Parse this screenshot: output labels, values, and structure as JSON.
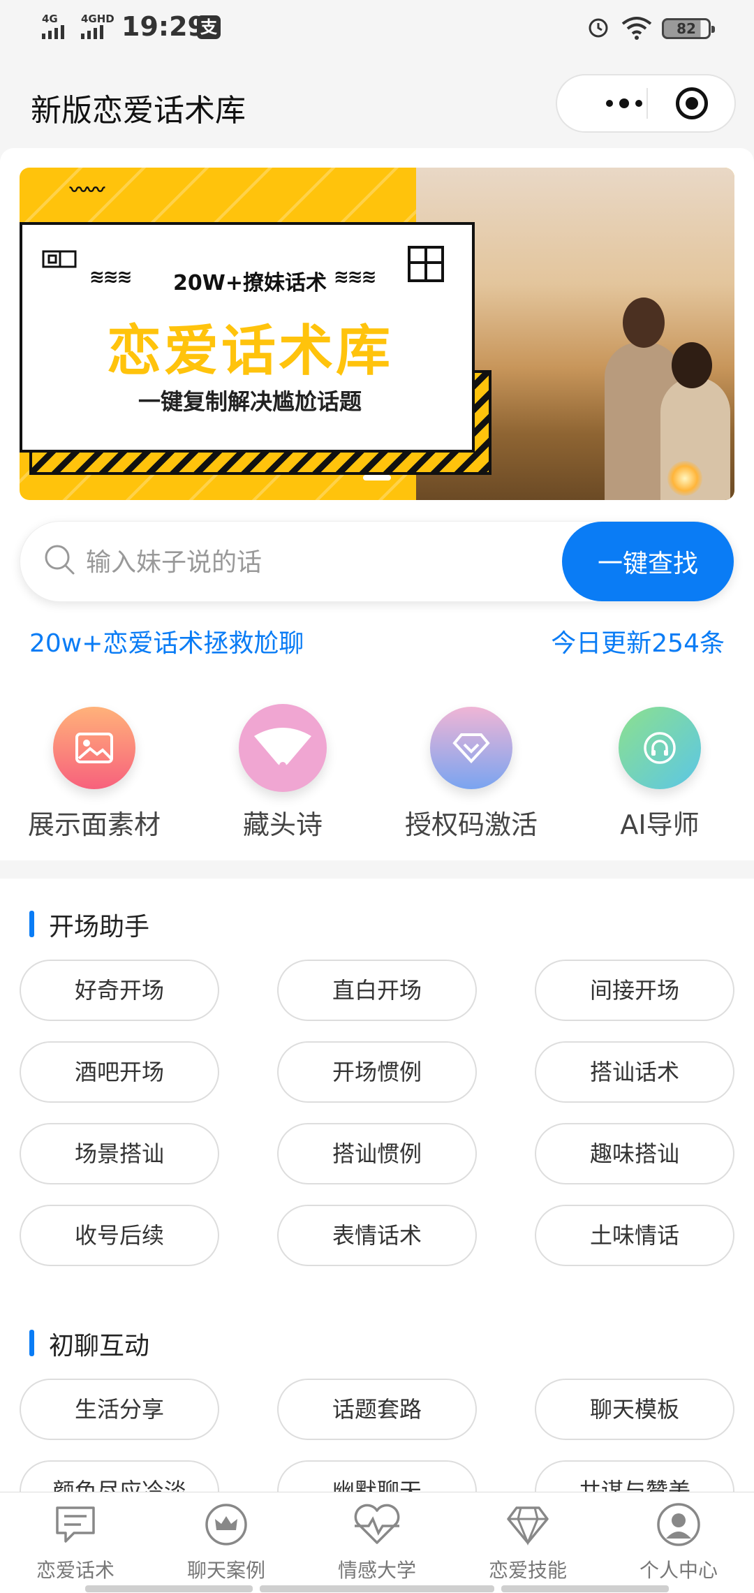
{
  "status_bar": {
    "signal1": "4G",
    "signal2": "4GHD",
    "time": "19:29",
    "pay_icon_label": "支",
    "battery": "82"
  },
  "navbar": {
    "title": "新版恋爱话术库"
  },
  "banner": {
    "subtitle": "20W+撩妹话术",
    "title": "恋爱话术库",
    "caption": "一键复制解决尴尬话题"
  },
  "search": {
    "placeholder": "输入妹子说的话",
    "button_label": "一键查找"
  },
  "info": {
    "left": "20w+恋爱话术拯救尬聊",
    "right": "今日更新254条"
  },
  "quick_actions": [
    {
      "label": "展示面素材",
      "icon": "image-icon",
      "color_from": "#ffb27a",
      "color_to": "#f7617c"
    },
    {
      "label": "藏头诗",
      "icon": "fan-icon",
      "color_from": "#f0a6d2",
      "color_to": "#f0a6d2"
    },
    {
      "label": "授权码激活",
      "icon": "diamond-icon",
      "color_from": "#f0b5d5",
      "color_to": "#7aa4f0"
    },
    {
      "label": "AI导师",
      "icon": "headset-icon",
      "color_from": "#8de08d",
      "color_to": "#5bc6e6"
    }
  ],
  "sections": [
    {
      "title": "开场助手",
      "items": [
        "好奇开场",
        "直白开场",
        "间接开场",
        "酒吧开场",
        "开场惯例",
        "搭讪话术",
        "场景搭讪",
        "搭讪惯例",
        "趣味搭讪",
        "收号后续",
        "表情话术",
        "土味情话"
      ]
    },
    {
      "title": "初聊互动",
      "items": [
        "生活分享",
        "话题套路",
        "聊天模板",
        "颜色尽应冷淡",
        "幽默聊天",
        "共谋与赞美"
      ]
    }
  ],
  "tabbar": [
    {
      "label": "恋爱话术",
      "icon": "chat-bubble-icon"
    },
    {
      "label": "聊天案例",
      "icon": "crown-icon"
    },
    {
      "label": "情感大学",
      "icon": "heartbeat-icon"
    },
    {
      "label": "恋爱技能",
      "icon": "diamond-outline-icon"
    },
    {
      "label": "个人中心",
      "icon": "user-icon"
    }
  ],
  "colors": {
    "accent": "#0a7cf5",
    "banner_yellow": "#ffc30c"
  }
}
